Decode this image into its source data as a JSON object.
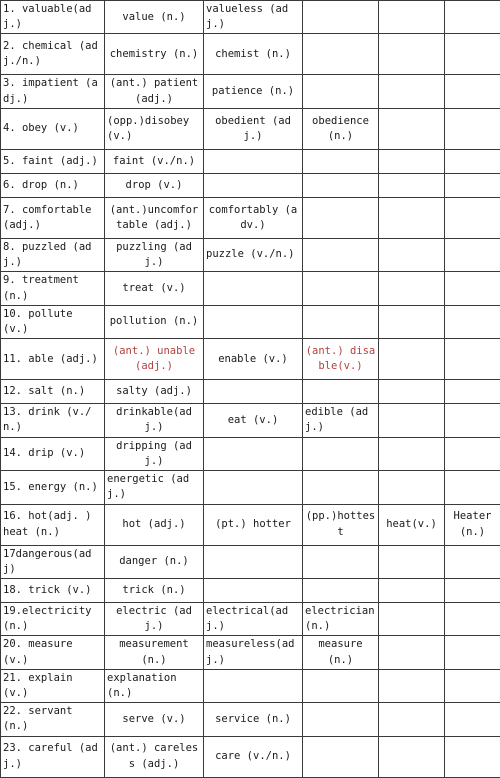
{
  "document": {
    "type": "word-formation-table",
    "columns": 6,
    "accent_color": "#b4413f",
    "border_color": "#3a3a3a",
    "text_color": "#1a1a1a"
  },
  "table": {
    "rows": [
      {
        "height": "short",
        "cells": [
          {
            "text": "1. valuable(adj.)",
            "align": "left",
            "color": "normal"
          },
          {
            "text": "value (n.)",
            "align": "center",
            "color": "normal"
          },
          {
            "text": "valueless (adj.)",
            "align": "left",
            "color": "normal"
          },
          {
            "text": "",
            "align": "center",
            "color": "normal"
          },
          {
            "text": "",
            "align": "center",
            "color": "normal"
          },
          {
            "text": "",
            "align": "center",
            "color": "normal"
          }
        ]
      },
      {
        "height": "tall",
        "cells": [
          {
            "text": "2. chemical (adj./n.)",
            "align": "left",
            "color": "normal"
          },
          {
            "text": "chemistry (n.)",
            "align": "center",
            "color": "normal"
          },
          {
            "text": "chemist (n.)",
            "align": "center",
            "color": "normal"
          },
          {
            "text": "",
            "align": "center",
            "color": "normal"
          },
          {
            "text": "",
            "align": "center",
            "color": "normal"
          },
          {
            "text": "",
            "align": "center",
            "color": "normal"
          }
        ]
      },
      {
        "height": "mid",
        "cells": [
          {
            "text": "3. impatient (adj.)",
            "align": "left",
            "color": "normal"
          },
          {
            "text": "(ant.) patient (adj.)",
            "align": "center",
            "color": "normal"
          },
          {
            "text": "patience (n.)",
            "align": "center",
            "color": "normal"
          },
          {
            "text": "",
            "align": "center",
            "color": "normal"
          },
          {
            "text": "",
            "align": "center",
            "color": "normal"
          },
          {
            "text": "",
            "align": "center",
            "color": "normal"
          }
        ]
      },
      {
        "height": "tall",
        "cells": [
          {
            "text": "4. obey (v.)",
            "align": "left",
            "color": "normal"
          },
          {
            "text": "(opp.)disobey (v.)",
            "align": "left",
            "color": "normal"
          },
          {
            "text": "obedient (adj.)",
            "align": "center",
            "color": "normal"
          },
          {
            "text": "obedience (n.)",
            "align": "center",
            "color": "normal"
          },
          {
            "text": "",
            "align": "center",
            "color": "normal"
          },
          {
            "text": "",
            "align": "center",
            "color": "normal"
          }
        ]
      },
      {
        "height": "short",
        "cells": [
          {
            "text": "5. faint (adj.)",
            "align": "left",
            "color": "normal"
          },
          {
            "text": "faint (v./n.)",
            "align": "center",
            "color": "normal"
          },
          {
            "text": "",
            "align": "center",
            "color": "normal"
          },
          {
            "text": "",
            "align": "center",
            "color": "normal"
          },
          {
            "text": "",
            "align": "center",
            "color": "normal"
          },
          {
            "text": "",
            "align": "center",
            "color": "normal"
          }
        ]
      },
      {
        "height": "short",
        "cells": [
          {
            "text": "6. drop (n.)",
            "align": "left",
            "color": "normal"
          },
          {
            "text": "drop (v.)",
            "align": "center",
            "color": "normal"
          },
          {
            "text": "",
            "align": "center",
            "color": "normal"
          },
          {
            "text": "",
            "align": "center",
            "color": "normal"
          },
          {
            "text": "",
            "align": "center",
            "color": "normal"
          },
          {
            "text": "",
            "align": "center",
            "color": "normal"
          }
        ]
      },
      {
        "height": "tall",
        "cells": [
          {
            "text": "7. comfortable (adj.)",
            "align": "left",
            "color": "normal"
          },
          {
            "text": "(ant.)uncomfortable (adj.)",
            "align": "center",
            "color": "normal"
          },
          {
            "text": "comfortably (adv.)",
            "align": "center",
            "color": "normal"
          },
          {
            "text": "",
            "align": "center",
            "color": "normal"
          },
          {
            "text": "",
            "align": "center",
            "color": "normal"
          },
          {
            "text": "",
            "align": "center",
            "color": "normal"
          }
        ]
      },
      {
        "height": "short",
        "cells": [
          {
            "text": "8. puzzled (adj.)",
            "align": "left",
            "color": "normal"
          },
          {
            "text": "puzzling (adj.)",
            "align": "center",
            "color": "normal"
          },
          {
            "text": "puzzle (v./n.)",
            "align": "left",
            "color": "normal"
          },
          {
            "text": "",
            "align": "center",
            "color": "normal"
          },
          {
            "text": "",
            "align": "center",
            "color": "normal"
          },
          {
            "text": "",
            "align": "center",
            "color": "normal"
          }
        ]
      },
      {
        "height": "short",
        "cells": [
          {
            "text": "9. treatment (n.)",
            "align": "left",
            "color": "normal"
          },
          {
            "text": "treat (v.)",
            "align": "center",
            "color": "normal"
          },
          {
            "text": "",
            "align": "center",
            "color": "normal"
          },
          {
            "text": "",
            "align": "center",
            "color": "normal"
          },
          {
            "text": "",
            "align": "center",
            "color": "normal"
          },
          {
            "text": "",
            "align": "center",
            "color": "normal"
          }
        ]
      },
      {
        "height": "short",
        "cells": [
          {
            "text": "10. pollute (v.)",
            "align": "left",
            "color": "normal"
          },
          {
            "text": "pollution (n.)",
            "align": "center",
            "color": "normal"
          },
          {
            "text": "",
            "align": "center",
            "color": "normal"
          },
          {
            "text": "",
            "align": "center",
            "color": "normal"
          },
          {
            "text": "",
            "align": "center",
            "color": "normal"
          },
          {
            "text": "",
            "align": "center",
            "color": "normal"
          }
        ]
      },
      {
        "height": "tall",
        "cells": [
          {
            "text": "11. able (adj.)",
            "align": "left",
            "color": "normal"
          },
          {
            "text": "(ant.) unable (adj.)",
            "align": "center",
            "color": "red"
          },
          {
            "text": "enable (v.)",
            "align": "center",
            "color": "normal"
          },
          {
            "text": "(ant.) disable(v.)",
            "align": "center",
            "color": "red"
          },
          {
            "text": "",
            "align": "center",
            "color": "normal"
          },
          {
            "text": "",
            "align": "center",
            "color": "normal"
          }
        ]
      },
      {
        "height": "short",
        "cells": [
          {
            "text": "12. salt (n.)",
            "align": "left",
            "color": "normal"
          },
          {
            "text": "salty (adj.)",
            "align": "center",
            "color": "normal"
          },
          {
            "text": "",
            "align": "center",
            "color": "normal"
          },
          {
            "text": "",
            "align": "center",
            "color": "normal"
          },
          {
            "text": "",
            "align": "center",
            "color": "normal"
          },
          {
            "text": "",
            "align": "center",
            "color": "normal"
          }
        ]
      },
      {
        "height": "short",
        "cells": [
          {
            "text": "13. drink (v./n.)",
            "align": "left",
            "color": "normal"
          },
          {
            "text": "drinkable(adj.)",
            "align": "center",
            "color": "normal"
          },
          {
            "text": "eat (v.)",
            "align": "center",
            "color": "normal"
          },
          {
            "text": "edible (adj.)",
            "align": "left",
            "color": "normal"
          },
          {
            "text": "",
            "align": "center",
            "color": "normal"
          },
          {
            "text": "",
            "align": "center",
            "color": "normal"
          }
        ]
      },
      {
        "height": "short",
        "cells": [
          {
            "text": "14. drip (v.)",
            "align": "left",
            "color": "normal"
          },
          {
            "text": "dripping (adj.)",
            "align": "center",
            "color": "normal"
          },
          {
            "text": "",
            "align": "center",
            "color": "normal"
          },
          {
            "text": "",
            "align": "center",
            "color": "normal"
          },
          {
            "text": "",
            "align": "center",
            "color": "normal"
          },
          {
            "text": "",
            "align": "center",
            "color": "normal"
          }
        ]
      },
      {
        "height": "short",
        "cells": [
          {
            "text": "15. energy (n.)",
            "align": "left",
            "color": "normal"
          },
          {
            "text": "energetic (adj.)",
            "align": "left",
            "color": "normal"
          },
          {
            "text": "",
            "align": "center",
            "color": "normal"
          },
          {
            "text": "",
            "align": "center",
            "color": "normal"
          },
          {
            "text": "",
            "align": "center",
            "color": "normal"
          },
          {
            "text": "",
            "align": "center",
            "color": "normal"
          }
        ]
      },
      {
        "height": "tall",
        "cells": [
          {
            "text": "16. hot(adj. ) heat (n.)",
            "align": "left",
            "color": "normal"
          },
          {
            "text": "hot (adj.)",
            "align": "center",
            "color": "normal"
          },
          {
            "text": "(pt.) hotter",
            "align": "center",
            "color": "normal"
          },
          {
            "text": "(pp.)hottest",
            "align": "center",
            "color": "normal"
          },
          {
            "text": "heat(v.)",
            "align": "center",
            "color": "normal"
          },
          {
            "text": "Heater (n.)",
            "align": "center",
            "color": "normal"
          }
        ]
      },
      {
        "height": "short",
        "cells": [
          {
            "text": "17dangerous(adj)",
            "align": "left",
            "color": "normal"
          },
          {
            "text": "danger (n.)",
            "align": "center",
            "color": "normal"
          },
          {
            "text": "",
            "align": "center",
            "color": "normal"
          },
          {
            "text": "",
            "align": "center",
            "color": "normal"
          },
          {
            "text": "",
            "align": "center",
            "color": "normal"
          },
          {
            "text": "",
            "align": "center",
            "color": "normal"
          }
        ]
      },
      {
        "height": "short",
        "cells": [
          {
            "text": "18. trick (v.)",
            "align": "left",
            "color": "normal"
          },
          {
            "text": "trick (n.)",
            "align": "center",
            "color": "normal"
          },
          {
            "text": "",
            "align": "center",
            "color": "normal"
          },
          {
            "text": "",
            "align": "center",
            "color": "normal"
          },
          {
            "text": "",
            "align": "center",
            "color": "normal"
          },
          {
            "text": "",
            "align": "center",
            "color": "normal"
          }
        ]
      },
      {
        "height": "short",
        "cells": [
          {
            "text": "19.electricity(n.)",
            "align": "left",
            "color": "normal"
          },
          {
            "text": "electric (adj.)",
            "align": "center",
            "color": "normal"
          },
          {
            "text": "electrical(adj.)",
            "align": "left",
            "color": "normal"
          },
          {
            "text": "electrician(n.)",
            "align": "left",
            "color": "normal"
          },
          {
            "text": "",
            "align": "center",
            "color": "normal"
          },
          {
            "text": "",
            "align": "center",
            "color": "normal"
          }
        ]
      },
      {
        "height": "short",
        "cells": [
          {
            "text": "20. measure (v.)",
            "align": "left",
            "color": "normal"
          },
          {
            "text": "measurement (n.)",
            "align": "center",
            "color": "normal"
          },
          {
            "text": "measureless(adj.)",
            "align": "left",
            "color": "normal"
          },
          {
            "text": "measure (n.)",
            "align": "center",
            "color": "normal"
          },
          {
            "text": "",
            "align": "center",
            "color": "normal"
          },
          {
            "text": "",
            "align": "center",
            "color": "normal"
          }
        ]
      },
      {
        "height": "short",
        "cells": [
          {
            "text": "21. explain (v.)",
            "align": "left",
            "color": "normal"
          },
          {
            "text": "explanation (n.)",
            "align": "left",
            "color": "normal"
          },
          {
            "text": "",
            "align": "center",
            "color": "normal"
          },
          {
            "text": "",
            "align": "center",
            "color": "normal"
          },
          {
            "text": "",
            "align": "center",
            "color": "normal"
          },
          {
            "text": "",
            "align": "center",
            "color": "normal"
          }
        ]
      },
      {
        "height": "short",
        "cells": [
          {
            "text": "22. servant (n.)",
            "align": "left",
            "color": "normal"
          },
          {
            "text": "serve (v.)",
            "align": "center",
            "color": "normal"
          },
          {
            "text": "service (n.)",
            "align": "center",
            "color": "normal"
          },
          {
            "text": "",
            "align": "center",
            "color": "normal"
          },
          {
            "text": "",
            "align": "center",
            "color": "normal"
          },
          {
            "text": "",
            "align": "center",
            "color": "normal"
          }
        ]
      },
      {
        "height": "tall",
        "cells": [
          {
            "text": "23. careful (adj.)",
            "align": "left",
            "color": "normal"
          },
          {
            "text": "(ant.) careless (adj.)",
            "align": "center",
            "color": "normal"
          },
          {
            "text": "care (v./n.)",
            "align": "center",
            "color": "normal"
          },
          {
            "text": "",
            "align": "center",
            "color": "normal"
          },
          {
            "text": "",
            "align": "center",
            "color": "normal"
          },
          {
            "text": "",
            "align": "center",
            "color": "normal"
          }
        ]
      }
    ]
  }
}
